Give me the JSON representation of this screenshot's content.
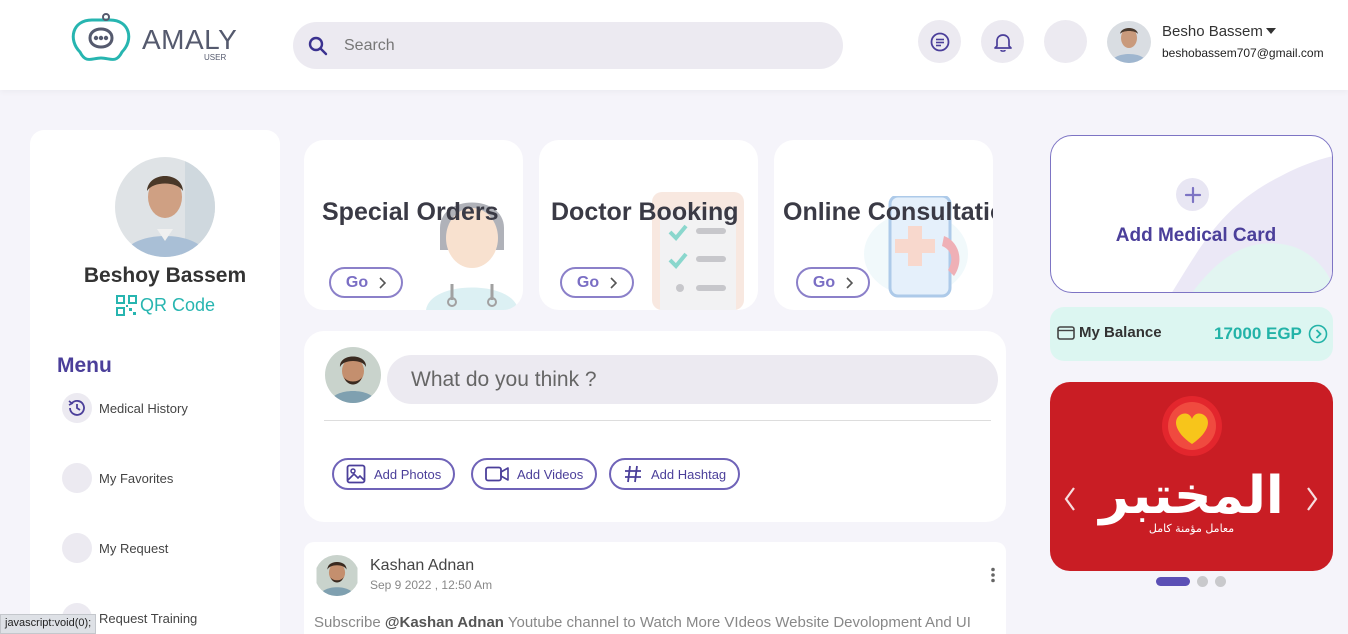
{
  "header": {
    "logo_text": "AMALY",
    "logo_sub": "USER",
    "search_placeholder": "Search",
    "user_name": "Besho Bassem",
    "user_email": "beshobassem707@gmail.com"
  },
  "sidebar": {
    "profile_name": "Beshoy Bassem",
    "qr_label": "QR Code",
    "menu_title": "Menu",
    "items": [
      {
        "label": "Medical History"
      },
      {
        "label": "My Favorites"
      },
      {
        "label": "My Request"
      },
      {
        "label": "Request Training"
      }
    ]
  },
  "services": [
    {
      "title": "Special Orders",
      "go": "Go"
    },
    {
      "title": "Doctor Booking",
      "go": "Go"
    },
    {
      "title": "Online Consultation",
      "go": "Go"
    }
  ],
  "composer": {
    "placeholder": "What do you think ?",
    "add_photos": "Add Photos",
    "add_videos": "Add Videos",
    "add_hashtag": "Add Hashtag"
  },
  "post": {
    "author": "Kashan Adnan",
    "date": "Sep 9 2022 , 12:50 Am",
    "body_prefix": "Subscribe ",
    "body_mention": "@Kashan Adnan",
    "body_rest": " Youtube channel to Watch More VIdeos Website Devolopment And UI"
  },
  "right": {
    "add_medical_card": "Add Medical Card",
    "balance_label": "My Balance",
    "balance_value": "17000 EGP",
    "banner_brand": "المختبر",
    "banner_tagline": "معامل مؤمنة كامل",
    "carousel_active_index": 0,
    "carousel_count": 3
  },
  "statusbar": "javascript:void(0);",
  "colors": {
    "primary": "#4b3f9a",
    "teal": "#27b5b0",
    "banner_red": "#c91d24"
  }
}
